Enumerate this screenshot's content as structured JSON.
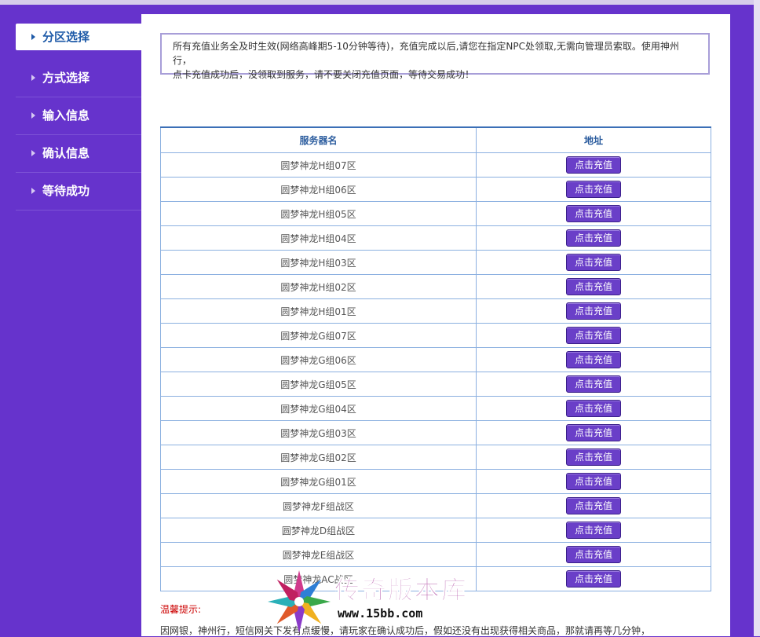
{
  "nav": {
    "items": [
      {
        "label": "分区选择",
        "active": true
      },
      {
        "label": "方式选择",
        "active": false
      },
      {
        "label": "输入信息",
        "active": false
      },
      {
        "label": "确认信息",
        "active": false
      },
      {
        "label": "等待成功",
        "active": false
      }
    ]
  },
  "notice": {
    "line1": "所有充值业务全及时生效(网络高峰期5-10分钟等待)，充值完成以后,请您在指定NPC处领取,无需向管理员索取。使用神州行，",
    "line2": "点卡充值成功后，没领取到服务，请不要关闭充值页面，等待交易成功！"
  },
  "table": {
    "header_name": "服务器名",
    "header_address": "地址",
    "button_label": "点击充值",
    "rows": [
      {
        "name": "圆梦神龙H组07区"
      },
      {
        "name": "圆梦神龙H组06区"
      },
      {
        "name": "圆梦神龙H组05区"
      },
      {
        "name": "圆梦神龙H组04区"
      },
      {
        "name": "圆梦神龙H组03区"
      },
      {
        "name": "圆梦神龙H组02区"
      },
      {
        "name": "圆梦神龙H组01区"
      },
      {
        "name": "圆梦神龙G组07区"
      },
      {
        "name": "圆梦神龙G组06区"
      },
      {
        "name": "圆梦神龙G组05区"
      },
      {
        "name": "圆梦神龙G组04区"
      },
      {
        "name": "圆梦神龙G组03区"
      },
      {
        "name": "圆梦神龙G组02区"
      },
      {
        "name": "圆梦神龙G组01区"
      },
      {
        "name": "圆梦神龙F组战区"
      },
      {
        "name": "圆梦神龙D组战区"
      },
      {
        "name": "圆梦神龙E组战区"
      },
      {
        "name": "圆梦神龙AC战区"
      }
    ]
  },
  "tips": {
    "title": "温馨提示:",
    "text": "因网银，神州行，短信网关下发有点缓慢，请玩家在确认成功后，假如还没有出现获得相关商品，那就请再等几分钟，"
  },
  "watermark": {
    "title": "传奇版本库",
    "url": "www.15bb.com"
  },
  "colors": {
    "background": "#6633cc",
    "button": "#6a3fc8",
    "header_text": "#2b5c9e",
    "tip_title": "#cc0000"
  }
}
